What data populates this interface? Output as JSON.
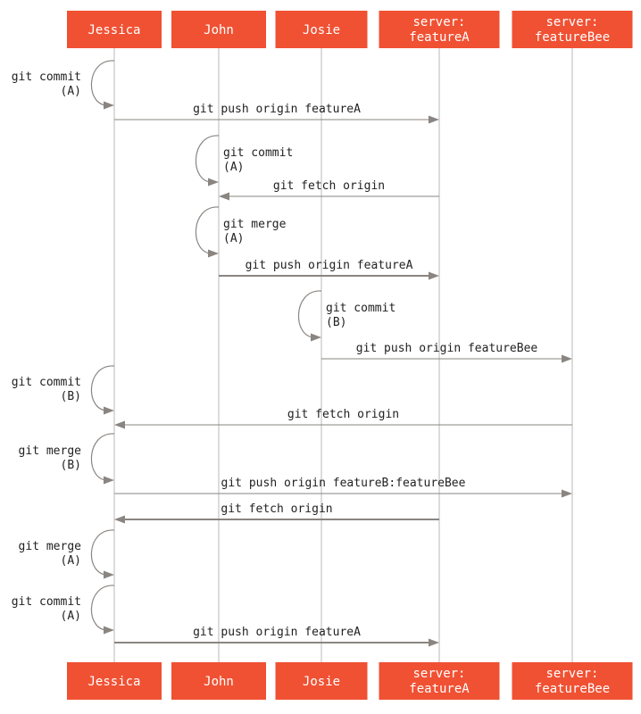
{
  "participants": [
    {
      "id": "jessica",
      "lines": [
        "Jessica"
      ]
    },
    {
      "id": "john",
      "lines": [
        "John"
      ]
    },
    {
      "id": "josie",
      "lines": [
        "Josie"
      ]
    },
    {
      "id": "serverA",
      "lines": [
        "server:",
        "featureA"
      ]
    },
    {
      "id": "serverB",
      "lines": [
        "server:",
        "featureBee"
      ]
    }
  ],
  "colors": {
    "box": "#f05133",
    "box_text": "#ffffff",
    "lines": "#8a8580"
  },
  "events": [
    {
      "type": "self",
      "actor": "jessica",
      "lines": [
        "git commit",
        "(A)"
      ]
    },
    {
      "type": "msg",
      "from": "jessica",
      "to": "serverA",
      "label": "git push origin featureA"
    },
    {
      "type": "self",
      "actor": "john",
      "lines": [
        "git commit",
        "(A)"
      ]
    },
    {
      "type": "msg",
      "from": "serverA",
      "to": "john",
      "label": "git fetch origin"
    },
    {
      "type": "self",
      "actor": "john",
      "lines": [
        "git merge",
        "(A)"
      ]
    },
    {
      "type": "msg",
      "from": "john",
      "to": "serverA",
      "label": "git push origin featureA",
      "bold": true
    },
    {
      "type": "self",
      "actor": "josie",
      "lines": [
        "git commit",
        "(B)"
      ]
    },
    {
      "type": "msg",
      "from": "josie",
      "to": "serverB",
      "label": "git push origin featureBee"
    },
    {
      "type": "self",
      "actor": "jessica",
      "lines": [
        "git commit",
        "(B)"
      ]
    },
    {
      "type": "msg",
      "from": "serverB",
      "to": "jessica",
      "label": "git fetch origin"
    },
    {
      "type": "self",
      "actor": "jessica",
      "lines": [
        "git merge",
        "(B)"
      ]
    },
    {
      "type": "msg",
      "from": "jessica",
      "to": "serverB",
      "label": "git push origin featureB:featureBee"
    },
    {
      "type": "msg",
      "from": "serverA",
      "to": "jessica",
      "label": "git fetch origin",
      "bold": true
    },
    {
      "type": "self",
      "actor": "jessica",
      "lines": [
        "git merge",
        "(A)"
      ]
    },
    {
      "type": "self",
      "actor": "jessica",
      "lines": [
        "git commit",
        "(A)"
      ]
    },
    {
      "type": "msg",
      "from": "jessica",
      "to": "serverA",
      "label": "git push origin featureA",
      "bold": true
    }
  ]
}
